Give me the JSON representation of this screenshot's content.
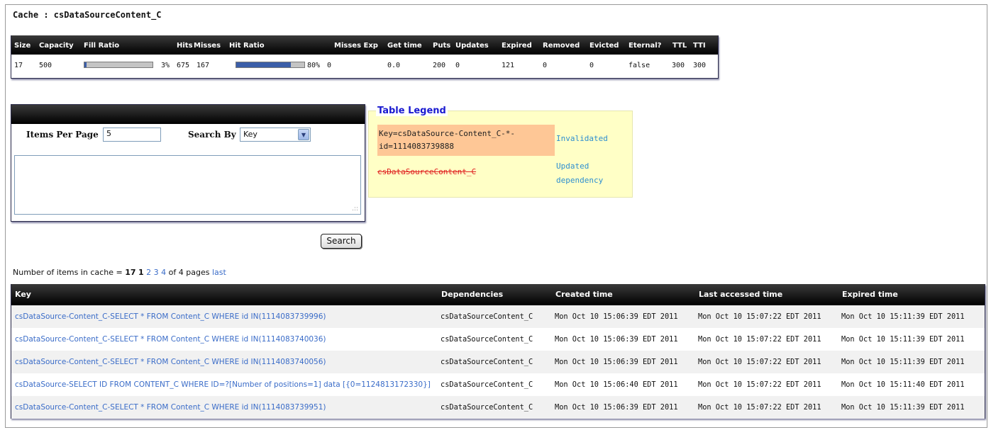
{
  "page": {
    "title": "Cache : csDataSourceContent_C"
  },
  "stats": {
    "headers": [
      "Size",
      "Capacity",
      "Fill Ratio",
      "Hits",
      "Misses",
      "Hit Ratio",
      "Misses Exp",
      "Get time",
      "Puts",
      "Updates",
      "Expired",
      "Removed",
      "Evicted",
      "Eternal?",
      "TTL",
      "TTI"
    ],
    "row": {
      "size": "17",
      "capacity": "500",
      "fill_ratio": 0.03,
      "fill_ratio_text": "3%",
      "hits": "675",
      "misses": "167",
      "hit_ratio": 0.8,
      "hit_ratio_text": "80%",
      "misses_exp": "0",
      "get_time": "0.0",
      "puts": "200",
      "updates": "0",
      "expired": "121",
      "removed": "0",
      "evicted": "0",
      "eternal": "false",
      "ttl": "300",
      "tti": "300"
    },
    "bar_colors": {
      "fill": "#3b5ea8",
      "track": "#c4c4c4"
    }
  },
  "search": {
    "items_per_page_label": "Items Per Page",
    "items_per_page_value": "5",
    "search_by_label": "Search By",
    "search_by_value": "Key",
    "search_button": "Search"
  },
  "legend": {
    "title": "Table Legend",
    "invalidated_key": "Key=csDataSource-Content_C-*-id=1114083739888",
    "invalidated_label": "Invalidated",
    "updated_key": "csDataSourceContent_C",
    "updated_label": "Updated dependency",
    "colors": {
      "invalidated_bg": "#fec796",
      "legend_bg": "#ffffc6",
      "updated_text": "#e02020"
    }
  },
  "pager": {
    "prefix": "Number of items in cache =",
    "count": "17",
    "current_page": "1",
    "pages": [
      "2",
      "3",
      "4"
    ],
    "suffix": "of 4 pages",
    "last": "last"
  },
  "items": {
    "headers": {
      "key": "Key",
      "dependencies": "Dependencies",
      "created": "Created time",
      "accessed": "Last accessed time",
      "expired": "Expired time"
    },
    "rows": [
      {
        "key": "csDataSource-Content_C-SELECT * FROM Content_C WHERE id IN(1114083739996)",
        "dependencies": "csDataSourceContent_C",
        "created": "Mon Oct 10 15:06:39 EDT 2011",
        "accessed": "Mon Oct 10 15:07:22 EDT 2011",
        "expired": "Mon Oct 10 15:11:39 EDT 2011"
      },
      {
        "key": "csDataSource-Content_C-SELECT * FROM Content_C WHERE id IN(1114083740036)",
        "dependencies": "csDataSourceContent_C",
        "created": "Mon Oct 10 15:06:39 EDT 2011",
        "accessed": "Mon Oct 10 15:07:22 EDT 2011",
        "expired": "Mon Oct 10 15:11:39 EDT 2011"
      },
      {
        "key": "csDataSource-Content_C-SELECT * FROM Content_C WHERE id IN(1114083740056)",
        "dependencies": "csDataSourceContent_C",
        "created": "Mon Oct 10 15:06:39 EDT 2011",
        "accessed": "Mon Oct 10 15:07:22 EDT 2011",
        "expired": "Mon Oct 10 15:11:39 EDT 2011"
      },
      {
        "key": "csDataSource-SELECT ID FROM CONTENT_C WHERE ID=?[Number of positions=1] data [{0=1124813172330}]",
        "dependencies": "csDataSourceContent_C",
        "created": "Mon Oct 10 15:06:40 EDT 2011",
        "accessed": "Mon Oct 10 15:07:22 EDT 2011",
        "expired": "Mon Oct 10 15:11:40 EDT 2011"
      },
      {
        "key": "csDataSource-Content_C-SELECT * FROM Content_C WHERE id IN(1114083739951)",
        "dependencies": "csDataSourceContent_C",
        "created": "Mon Oct 10 15:06:39 EDT 2011",
        "accessed": "Mon Oct 10 15:07:22 EDT 2011",
        "expired": "Mon Oct 10 15:11:39 EDT 2011"
      }
    ]
  }
}
